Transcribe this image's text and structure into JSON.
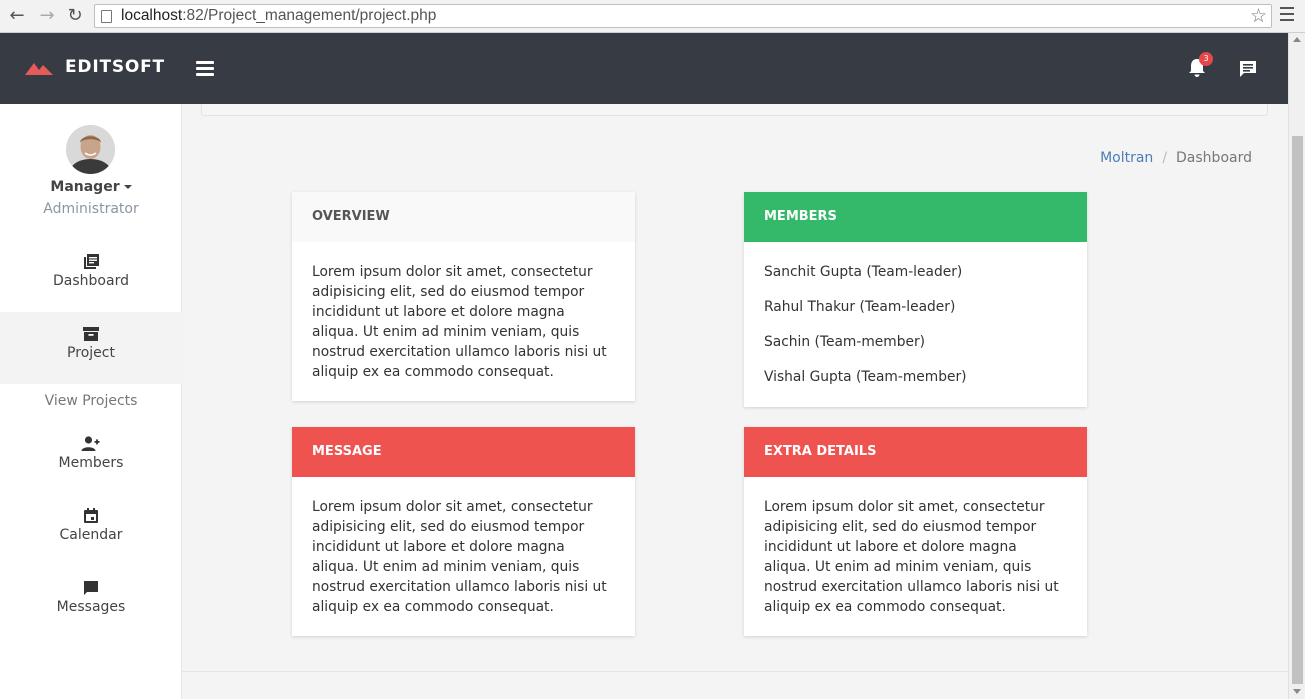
{
  "browser": {
    "url_host": "localhost",
    "url_path": ":82/Project_management/project.php"
  },
  "topbar": {
    "brand": "EDITSOFT",
    "notification_count": "3"
  },
  "sidebar": {
    "user_name": "Manager",
    "user_role": "Administrator",
    "items": [
      {
        "label": "Dashboard",
        "icon": "library-books-icon"
      },
      {
        "label": "Project",
        "icon": "archive-icon"
      },
      {
        "label": "Members",
        "icon": "person-add-icon"
      },
      {
        "label": "Calendar",
        "icon": "calendar-icon"
      },
      {
        "label": "Messages",
        "icon": "chat-bubble-icon"
      }
    ],
    "sub_item": "View Projects"
  },
  "breadcrumb": {
    "root": "Moltran",
    "current": "Dashboard"
  },
  "cards": {
    "overview": {
      "title": "OVERVIEW",
      "text": "Lorem ipsum dolor sit amet, consectetur adipisicing elit, sed do eiusmod tempor incididunt ut labore et dolore magna aliqua. Ut enim ad minim veniam, quis nostrud exercitation ullamco laboris nisi ut aliquip ex ea commodo consequat."
    },
    "members": {
      "title": "MEMBERS",
      "list": [
        "Sanchit Gupta (Team-leader)",
        "Rahul Thakur (Team-leader)",
        "Sachin (Team-member)",
        "Vishal Gupta (Team-member)"
      ]
    },
    "message": {
      "title": "MESSAGE",
      "text": "Lorem ipsum dolor sit amet, consectetur adipisicing elit, sed do eiusmod tempor incididunt ut labore et dolore magna aliqua. Ut enim ad minim veniam, quis nostrud exercitation ullamco laboris nisi ut aliquip ex ea commodo consequat."
    },
    "extra": {
      "title": "EXTRA DETAILS",
      "text": "Lorem ipsum dolor sit amet, consectetur adipisicing elit, sed do eiusmod tempor incididunt ut labore et dolore magna aliqua. Ut enim ad minim veniam, quis nostrud exercitation ullamco laboris nisi ut aliquip ex ea commodo consequat."
    }
  },
  "colors": {
    "topbar": "#363b44",
    "brand_mark": "#e65a5a",
    "green_header": "#34b96b",
    "red_header": "#ef5350",
    "badge": "#e6484a",
    "link": "#4a7fb5"
  }
}
